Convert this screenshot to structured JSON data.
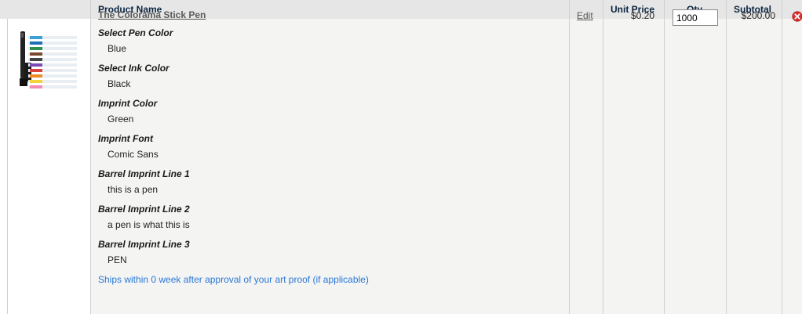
{
  "table": {
    "headers": {
      "product_name": "Product Name",
      "unit_price": "Unit Price",
      "qty": "Qty",
      "subtotal": "Subtotal"
    }
  },
  "item": {
    "name": "The Colorama Stick Pen",
    "edit_label": "Edit",
    "unit_price": "$0.20",
    "qty": "1000",
    "subtotal": "$200.00",
    "options": [
      {
        "label": "Select Pen Color",
        "value": "Blue"
      },
      {
        "label": "Select Ink Color",
        "value": "Black"
      },
      {
        "label": "Imprint Color",
        "value": "Green"
      },
      {
        "label": "Imprint Font",
        "value": "Comic Sans"
      },
      {
        "label": "Barrel Imprint Line 1",
        "value": "this is a pen"
      },
      {
        "label": "Barrel Imprint Line 2",
        "value": "a pen is what this is"
      },
      {
        "label": "Barrel Imprint Line 3",
        "value": "PEN"
      }
    ],
    "shipping_note": "Ships within 0 week after approval of your art proof (if applicable)"
  },
  "icons": {
    "remove": "remove-item-icon",
    "thumbnail": "product-thumbnail"
  },
  "colors": {
    "header_bg": "#e6e6e6",
    "row_bg": "#f4f4f2",
    "link_blue": "#2a78d8",
    "remove_red": "#d9302c"
  }
}
